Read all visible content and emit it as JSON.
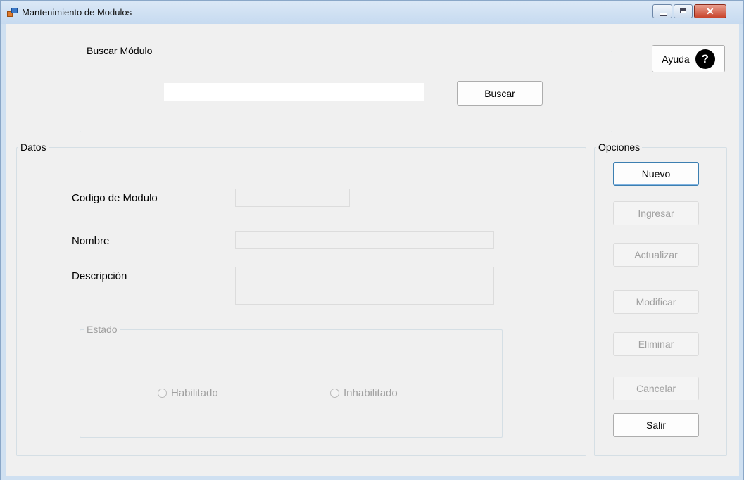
{
  "window": {
    "title": "Mantenimiento de Modulos"
  },
  "search": {
    "group_title": "Buscar Módulo",
    "input_value": "",
    "button_label": "Buscar"
  },
  "help": {
    "button_label": "Ayuda",
    "icon_glyph": "?"
  },
  "datos": {
    "group_title": "Datos",
    "codigo_label": "Codigo de Modulo",
    "nombre_label": "Nombre",
    "descripcion_label": "Descripción",
    "codigo_value": "",
    "nombre_value": "",
    "descripcion_value": "",
    "estado": {
      "group_title": "Estado",
      "options": [
        "Habilitado",
        "Inhabilitado"
      ]
    }
  },
  "opciones": {
    "group_title": "Opciones",
    "nuevo": "Nuevo",
    "ingresar": "Ingresar",
    "actualizar": "Actualizar",
    "modificar": "Modificar",
    "eliminar": "Eliminar",
    "cancelar": "Cancelar",
    "salir": "Salir"
  }
}
